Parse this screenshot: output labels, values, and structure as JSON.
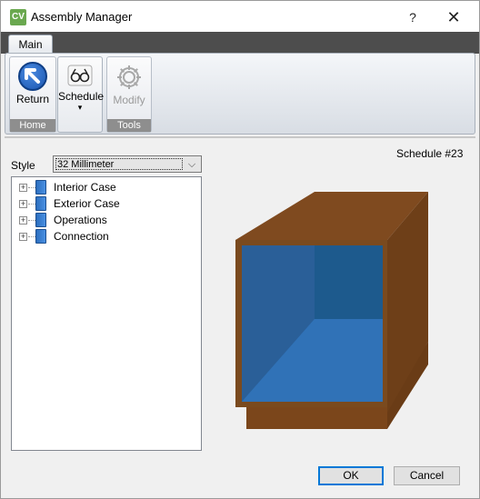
{
  "window": {
    "app_icon_text": "CV",
    "title": "Assembly Manager",
    "help_label": "?",
    "close_label": "✕"
  },
  "ribbon": {
    "tabs": [
      {
        "label": "Main"
      }
    ],
    "groups": [
      {
        "label": "Home",
        "buttons": [
          {
            "label": "Return",
            "icon": "return-arrow-icon"
          }
        ]
      },
      {
        "label": "",
        "buttons": [
          {
            "label": "Schedule",
            "icon": "glasses-icon",
            "dropdown_indicator": "▾"
          }
        ]
      },
      {
        "label": "Tools",
        "buttons": [
          {
            "label": "Modify",
            "icon": "gear-icon",
            "disabled": true
          }
        ]
      }
    ]
  },
  "main": {
    "schedule_label": "Schedule #23",
    "style_label": "Style",
    "style_value": "32 Millimeter",
    "style_chevron": "⌵",
    "tree": [
      {
        "label": "Interior Case",
        "expander": "+"
      },
      {
        "label": "Exterior Case",
        "expander": "+"
      },
      {
        "label": "Operations",
        "expander": "+"
      },
      {
        "label": "Connection",
        "expander": "+"
      }
    ]
  },
  "buttons": {
    "ok_label": "OK",
    "cancel_label": "Cancel"
  },
  "colors": {
    "cabinet_brown": "#7a4a1e",
    "cabinet_blue": "#2e6db3",
    "accent": "#0078d7"
  }
}
